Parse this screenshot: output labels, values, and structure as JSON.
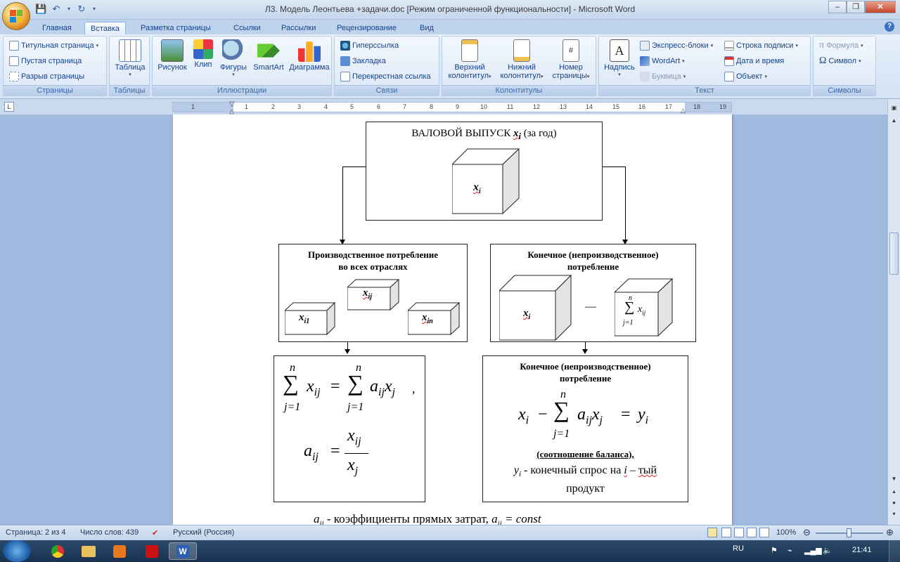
{
  "window": {
    "title": "Л3. Модель Леонтьева +задачи.doc [Режим ограниченной функциональности] - Microsoft Word"
  },
  "tabs": [
    "Главная",
    "Вставка",
    "Разметка страницы",
    "Ссылки",
    "Рассылки",
    "Рецензирование",
    "Вид"
  ],
  "active_tab": "Вставка",
  "ribbon": {
    "pages": {
      "label": "Страницы",
      "items": [
        "Титульная страница",
        "Пустая страница",
        "Разрыв страницы"
      ]
    },
    "tables": {
      "label": "Таблицы",
      "items": [
        "Таблица"
      ]
    },
    "illustrations": {
      "label": "Иллюстрации",
      "items": [
        "Рисунок",
        "Клип",
        "Фигуры",
        "SmartArt",
        "Диаграмма"
      ]
    },
    "links": {
      "label": "Связи",
      "items": [
        "Гиперссылка",
        "Закладка",
        "Перекрестная ссылка"
      ]
    },
    "headers": {
      "label": "Колонтитулы",
      "items": [
        "Верхний колонтитул",
        "Нижний колонтитул",
        "Номер страницы"
      ]
    },
    "header_lines": [
      [
        "Верхний",
        "колонтитул"
      ],
      [
        "Нижний",
        "колонтитул"
      ],
      [
        "Номер",
        "страницы"
      ]
    ],
    "text": {
      "label": "Текст",
      "big": "Надпись",
      "items": [
        "Экспресс-блоки",
        "WordArt",
        "Буквица",
        "Строка подписи",
        "Дата и время",
        "Объект"
      ]
    },
    "symbols": {
      "label": "Символы",
      "items": [
        "Формула",
        "Символ"
      ]
    }
  },
  "ruler": {
    "numbers": [
      "1",
      "1",
      "2",
      "3",
      "4",
      "5",
      "6",
      "7",
      "8",
      "9",
      "10",
      "11",
      "12",
      "13",
      "14",
      "15",
      "16",
      "17",
      "18",
      "19"
    ]
  },
  "document": {
    "top_box": {
      "title_prefix": "ВАЛОВОЙ ВЫПУСК",
      "title_var": "x",
      "title_sub": "i",
      "title_suffix": " (за год)",
      "cube_label": "x",
      "cube_sub": "i"
    },
    "left_box": {
      "title_line1": "Производственное потребление",
      "title_line2": "во всех отраслях",
      "cube1": "x",
      "cube1_sub": "i1",
      "cube2": "x",
      "cube2_sub": "ij",
      "cube3": "x",
      "cube3_sub": "in"
    },
    "right_box": {
      "title_line1": "Конечное (непроизводственное)",
      "title_line2": "потребление",
      "cube_label": "x",
      "cube_sub": "i",
      "sum_top": "n",
      "sum_bottom": "j=1",
      "sum_term": "x",
      "sum_term_sub": "ij",
      "minus": "—"
    },
    "left_formula": {
      "sum_top": "n",
      "sum_bottom": "j=1",
      "term1": "x",
      "term1_sub": "ij",
      "equals": "=",
      "term2": "a",
      "term2_sub": "ij",
      "term3": "x",
      "term3_sub": "j",
      "comma": ",",
      "frac_left": "a",
      "frac_left_sub": "ij",
      "frac_num": "x",
      "frac_num_sub": "ij",
      "frac_den": "x",
      "frac_den_sub": "j"
    },
    "right_formula": {
      "title_line1": "Конечное (непроизводственное)",
      "title_line2": "потребление",
      "lhs": "x",
      "lhs_sub": "i",
      "minus": "−",
      "sum_top": "n",
      "sum_bottom": "j=1",
      "t1": "a",
      "t1_sub": "ij",
      "t2": "x",
      "t2_sub": "j",
      "equals": "=",
      "rhs": "y",
      "rhs_sub": "i",
      "balance": "(соотношение баланса),",
      "demand_var": "y",
      "demand_sub": "i",
      "demand_text_pre": " - конечный спрос на ",
      "demand_i": "i",
      "demand_text_dash": " – ",
      "demand_text_ty": "тый",
      "demand_text_product": "продукт"
    },
    "bottom_line": {
      "var": "a",
      "sub": "ij",
      "text": " - коэффициенты прямых затрат, ",
      "var2": "a",
      "sub2": "ij",
      "eq": " = ",
      "const": "const"
    }
  },
  "status": {
    "page": "Страница: 2 из 4",
    "words": "Число слов: 439",
    "lang": "Русский (Россия)",
    "zoom": "100%"
  },
  "taskbar": {
    "lang": "RU",
    "time": "21:41"
  },
  "colors": {
    "accent": "#15428b",
    "doc_bg": "#9fb9df"
  }
}
